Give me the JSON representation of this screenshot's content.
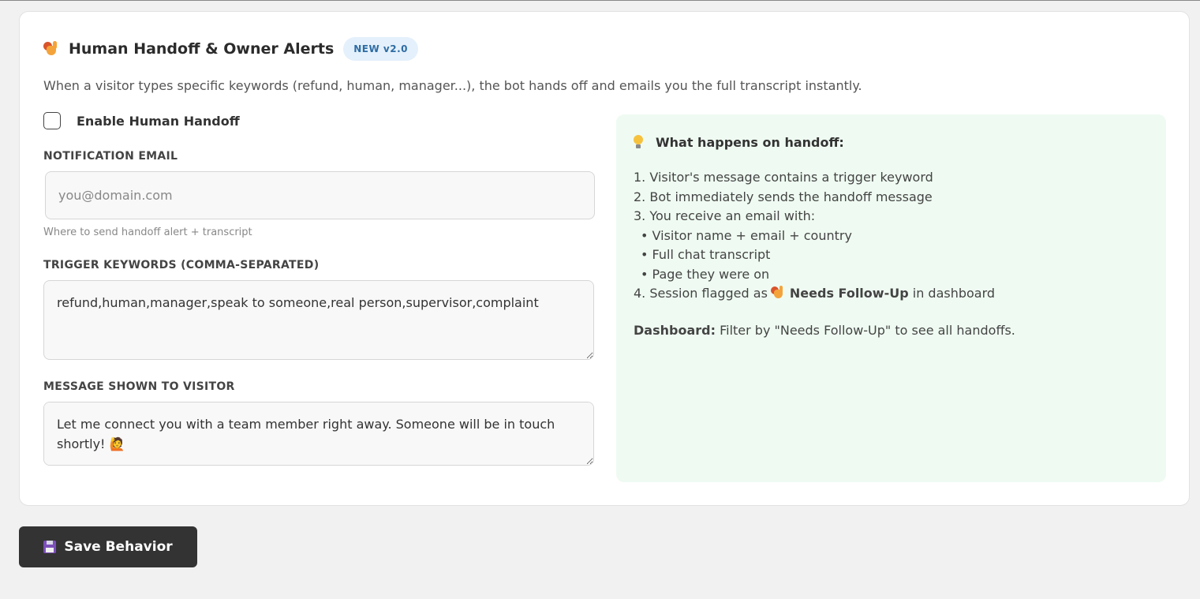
{
  "header": {
    "title": "Human Handoff & Owner Alerts",
    "badge": "NEW v2.0",
    "icon": "raising-hand-icon"
  },
  "description": "When a visitor types specific keywords (refund, human, manager...), the bot hands off and emails you the full transcript instantly.",
  "enable": {
    "label": "Enable Human Handoff",
    "checked": false
  },
  "email": {
    "label": "NOTIFICATION EMAIL",
    "placeholder": "you@domain.com",
    "value": "",
    "hint": "Where to send handoff alert + transcript"
  },
  "keywords": {
    "label": "TRIGGER KEYWORDS (COMMA-SEPARATED)",
    "value": "refund,human,manager,speak to someone,real person,supervisor,complaint"
  },
  "message": {
    "label": "MESSAGE SHOWN TO VISITOR",
    "value": "Let me connect you with a team member right away. Someone will be in touch shortly! 🙋"
  },
  "info_panel": {
    "title": "What happens on handoff:",
    "icon": "light-bulb-icon",
    "steps": [
      "1. Visitor's message contains a trigger keyword",
      "2. Bot immediately sends the handoff message",
      "3. You receive an email with:"
    ],
    "sub_items": [
      "• Visitor name + email + country",
      "• Full chat transcript",
      "• Page they were on"
    ],
    "step4_prefix": "4. Session flagged as",
    "step4_bold": "Needs Follow-Up",
    "step4_suffix": "in dashboard",
    "dashboard_label": "Dashboard:",
    "dashboard_text": "Filter by \"Needs Follow-Up\" to see all handoffs."
  },
  "save_button": {
    "label": "Save Behavior",
    "icon": "floppy-disk-icon"
  },
  "colors": {
    "badge_bg": "#e4f0fb",
    "badge_text": "#2e6da4",
    "panel_bg": "#effbf2",
    "button_bg": "#333333"
  }
}
